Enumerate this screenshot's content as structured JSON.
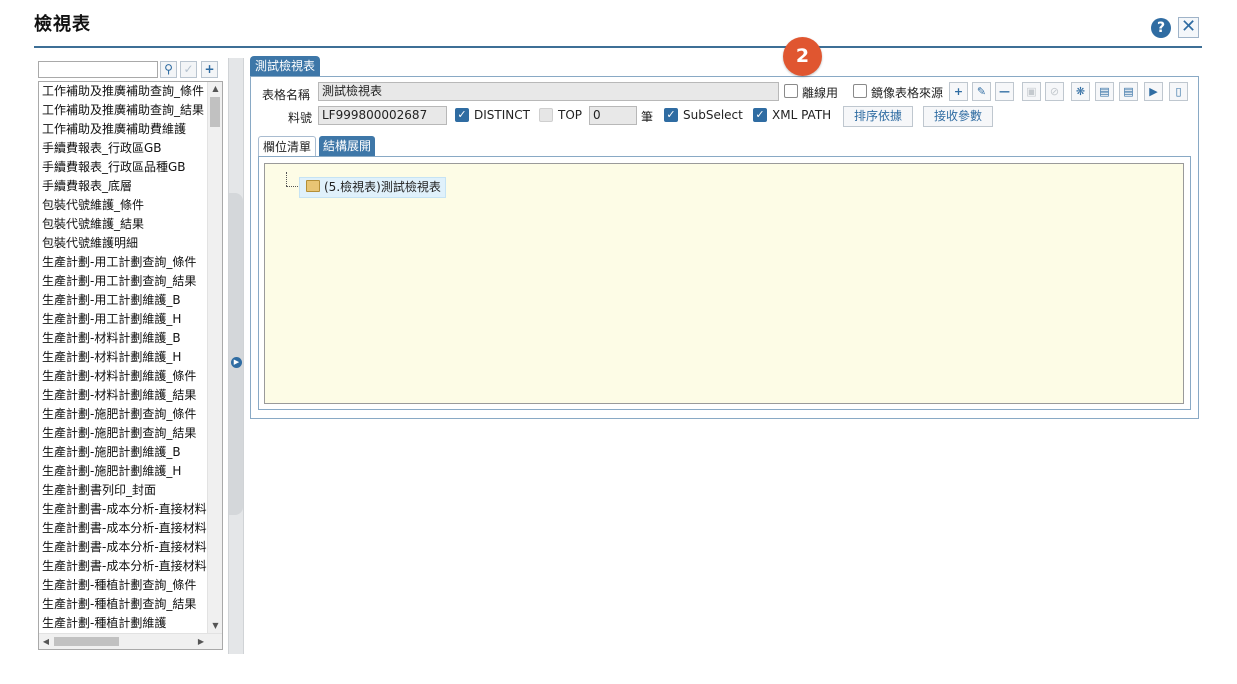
{
  "dialog": {
    "title": "檢視表",
    "help_label": "?",
    "close_label": "✕"
  },
  "left": {
    "search_value": "",
    "items": [
      "工作補助及推廣補助查詢_條件",
      "工作補助及推廣補助查詢_結果",
      "工作補助及推廣補助費維護",
      "手續費報表_行政區GB",
      "手續費報表_行政區品種GB",
      "手續費報表_底層",
      "包裝代號維護_條件",
      "包裝代號維護_結果",
      "包裝代號維護明細",
      "生產計劃-用工計劃查詢_條件",
      "生產計劃-用工計劃查詢_結果",
      "生產計劃-用工計劃維護_B",
      "生產計劃-用工計劃維護_H",
      "生產計劃-材料計劃維護_B",
      "生產計劃-材料計劃維護_H",
      "生產計劃-材料計劃維護_條件",
      "生產計劃-材料計劃維護_結果",
      "生產計劃-施肥計劃查詢_條件",
      "生產計劃-施肥計劃查詢_結果",
      "生產計劃-施肥計劃維護_B",
      "生產計劃-施肥計劃維護_H",
      "生產計劃書列印_封面",
      "生產計劃書-成本分析-直接材料",
      "生產計劃書-成本分析-直接材料",
      "生產計劃書-成本分析-直接材料",
      "生產計劃書-成本分析-直接材料",
      "生產計劃-種植計劃查詢_條件",
      "生產計劃-種植計劃查詢_結果",
      "生產計劃-種植計劃維護"
    ]
  },
  "main": {
    "tab_label": "測試檢視表",
    "badge": "2",
    "table_name_label": "表格名稱",
    "table_name_value": "測試檢視表",
    "offline_label": "離線用",
    "mirror_label": "鏡像表格來源",
    "part_no_label": "料號",
    "part_no_value": "LF999800002687",
    "distinct_label": "DISTINCT",
    "top_label": "TOP",
    "top_value": "0",
    "unit_label": "筆",
    "subselect_label": "SubSelect",
    "xmlpath_label": "XML PATH",
    "sort_button": "排序依據",
    "receive_button": "接收參數",
    "tabs": [
      "欄位清單",
      "結構展開"
    ],
    "tree_node": "(5.檢視表)測試檢視表"
  },
  "icons": {
    "toolbar": [
      "plus-icon",
      "edit-icon",
      "minus-icon",
      "save-icon",
      "cancel-icon",
      "bug-icon",
      "list-icon",
      "document-icon",
      "play-icon",
      "clipboard-icon"
    ]
  }
}
